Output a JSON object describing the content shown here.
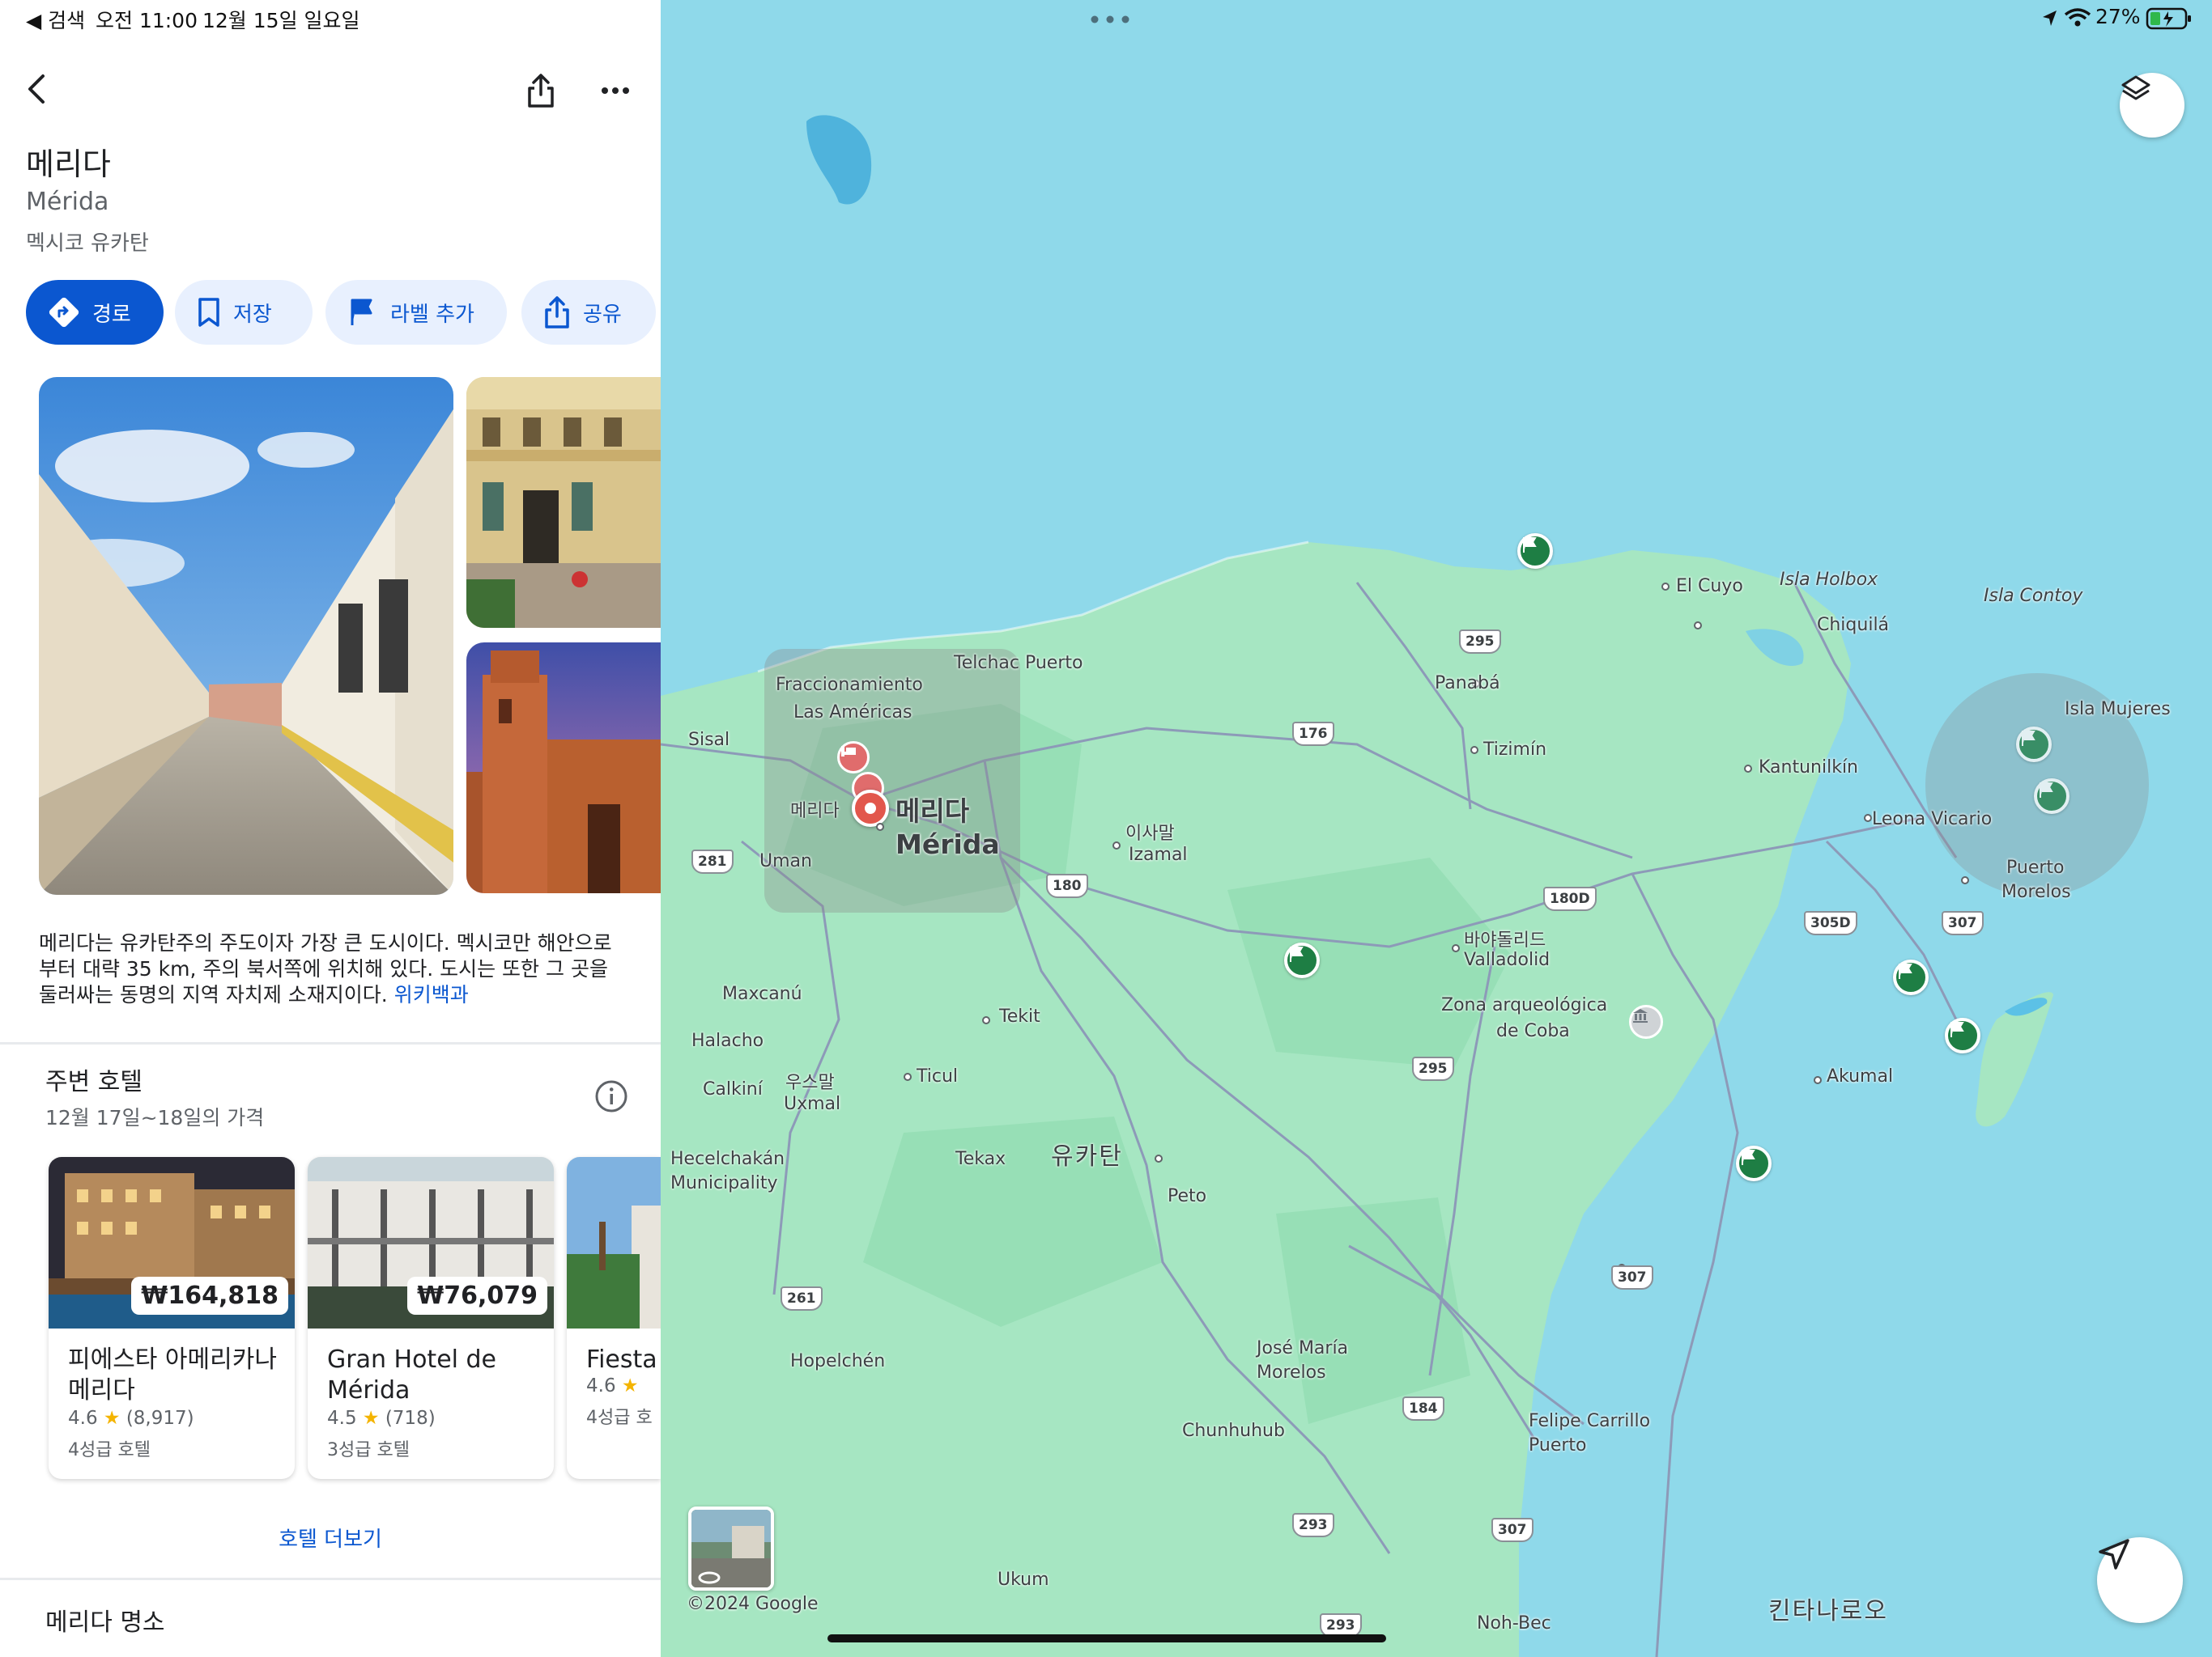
{
  "status_bar": {
    "back_app": "◀ 검색",
    "time": "오전 11:00",
    "date": "12월 15일 일요일",
    "battery": "27%"
  },
  "place": {
    "title": "메리다",
    "subtitle": "Mérida",
    "region": "멕시코 유카탄"
  },
  "actions": {
    "directions": "경로",
    "save": "저장",
    "label": "라벨 추가",
    "share": "공유"
  },
  "description": {
    "text": "메리다는 유카탄주의 주도이자 가장 큰 도시이다. 멕시코만 해안으로부터 대략 35 km, 주의 북서쪽에 위치해 있다. 도시는 또한 그 곳을 둘러싸는 동명의 지역 자치제 소재지이다.",
    "link": "위키백과"
  },
  "hotels": {
    "title": "주변 호텔",
    "dates": "12월 17일~18일의 가격",
    "items": [
      {
        "price": "₩164,818",
        "name": "피에스타 아메리카나 메리다",
        "rating": "4.6",
        "reviews": "(8,917)",
        "class": "4성급 호텔"
      },
      {
        "price": "₩76,079",
        "name": "Gran Hotel de Mérida",
        "rating": "4.5",
        "reviews": "(718)",
        "class": "3성급 호텔"
      },
      {
        "price": "",
        "name": "Fiesta",
        "rating": "4.6",
        "reviews": "",
        "class": "4성급 호"
      }
    ],
    "more": "호텔 더보기"
  },
  "attractions": {
    "title": "메리다 명소"
  },
  "map": {
    "labels": {
      "merida_ko": "메리다",
      "merida_en": "Mérida",
      "merida_small": "메리다",
      "fracc": "Fraccionamiento",
      "fracc2": "Las Américas",
      "telchac": "Telchac Puerto",
      "sisal": "Sisal",
      "uman": "Uman",
      "el_cuyo": "El Cuyo",
      "holbox": "Isla Holbox",
      "contoy": "Isla Contoy",
      "chiquila": "Chiquilá",
      "panaba": "Panabá",
      "tizimin": "Tizimín",
      "kantunilkin": "Kantunilkín",
      "mujeres": "Isla Mujeres",
      "leona": "Leona Vicario",
      "izamal_ko": "이사말",
      "izamal": "Izamal",
      "puerto_morelos": "Puerto",
      "puerto_morelos2": "Morelos",
      "valladolid_ko": "바야돌리드",
      "valladolid": "Valladolid",
      "coba": "Zona arqueológica",
      "coba2": "de Coba",
      "maxcanu": "Maxcanú",
      "tekit": "Tekit",
      "halacho": "Halacho",
      "uxmal_ko": "우스말",
      "uxmal": "Uxmal",
      "calkini": "Calkiní",
      "ticul": "Ticul",
      "akumal": "Akumal",
      "hecel": "Hecelchakán",
      "hecel2": "Municipality",
      "tekax": "Tekax",
      "yucatan": "유카탄",
      "peto": "Peto",
      "hopelchen": "Hopelchén",
      "jose": "José María",
      "jose2": "Morelos",
      "chunhuhub": "Chunhuhub",
      "felipe": "Felipe Carrillo",
      "felipe2": "Puerto",
      "ukum": "Ukum",
      "noh_bec": "Noh-Bec",
      "quintana": "킨타나로오",
      "copyright": "©2024 Google"
    },
    "routes": [
      "295",
      "176",
      "281",
      "180",
      "180D",
      "305D",
      "307",
      "295",
      "261",
      "307",
      "184",
      "293",
      "307",
      "293"
    ]
  },
  "colors": {
    "water": "#8fd9ea",
    "land": "#9fe3bd",
    "accent": "#0b57d0",
    "pin": "#1e7e44"
  }
}
